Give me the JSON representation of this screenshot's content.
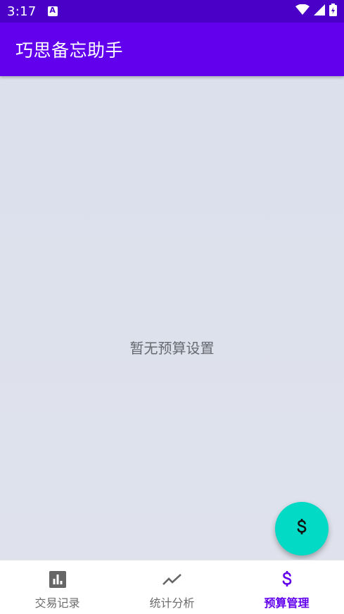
{
  "status_bar": {
    "time": "3:17",
    "icons": [
      "a-notification-icon",
      "wifi-icon",
      "signal-icon",
      "battery-icon"
    ]
  },
  "app_bar": {
    "title": "巧思备忘助手"
  },
  "main": {
    "empty_message": "暂无预算设置"
  },
  "fab": {
    "icon": "dollar-icon"
  },
  "bottom_nav": {
    "items": [
      {
        "label": "交易记录",
        "icon": "bar-chart-icon",
        "active": false
      },
      {
        "label": "统计分析",
        "icon": "trending-line-icon",
        "active": false
      },
      {
        "label": "预算管理",
        "icon": "dollar-icon",
        "active": true
      }
    ]
  },
  "colors": {
    "status_bar": "#4b00c8",
    "primary": "#6200ee",
    "fab": "#03dac5",
    "background": "#dbe0ec"
  }
}
